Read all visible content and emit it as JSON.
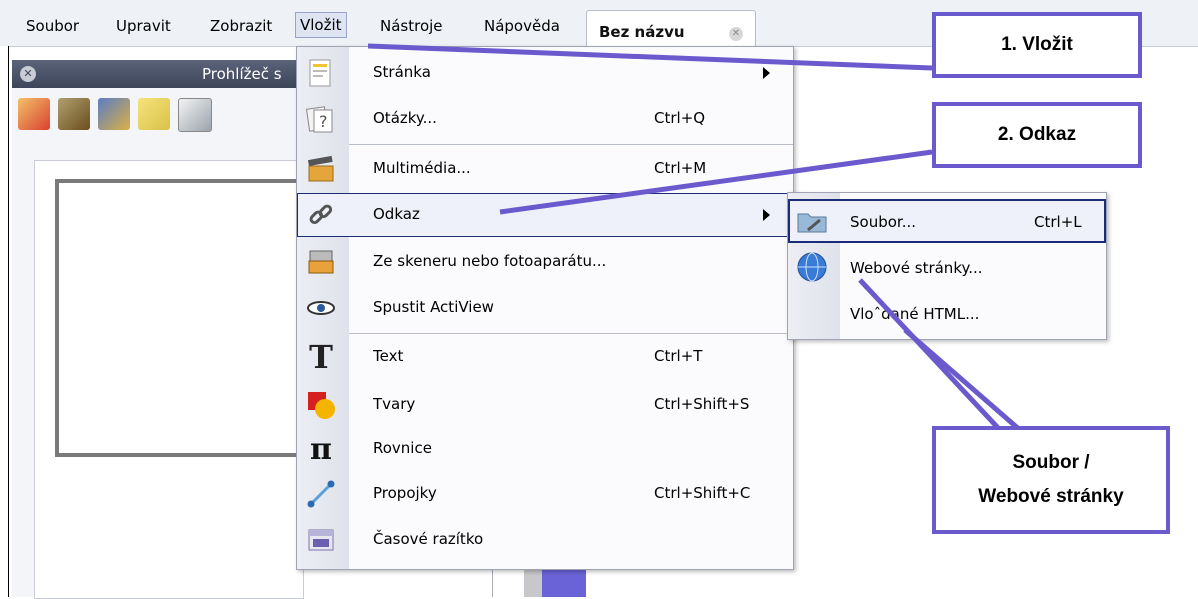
{
  "menubar": {
    "items": [
      "Soubor",
      "Upravit",
      "Zobrazit",
      "Vložit",
      "Nástroje",
      "Nápověda"
    ],
    "active": "Vložit"
  },
  "document_tab": {
    "label": "Bez názvu"
  },
  "browser_panel": {
    "title": "Prohlížeč s"
  },
  "insert_menu": {
    "items": [
      {
        "label": "Stránka",
        "shortcut": "",
        "submenu": true
      },
      {
        "label": "Otázky...",
        "shortcut": "Ctrl+Q"
      },
      {
        "label": "Multimédia...",
        "shortcut": "Ctrl+M"
      },
      {
        "label": "Odkaz",
        "shortcut": "",
        "submenu": true
      },
      {
        "label": "Ze skeneru nebo fotoaparátu...",
        "shortcut": ""
      },
      {
        "label": "Spustit ActiView",
        "shortcut": ""
      },
      {
        "label": "Text",
        "shortcut": "Ctrl+T"
      },
      {
        "label": "Tvary",
        "shortcut": "Ctrl+Shift+S"
      },
      {
        "label": "Rovnice",
        "shortcut": ""
      },
      {
        "label": "Propojky",
        "shortcut": "Ctrl+Shift+C"
      },
      {
        "label": "Časové razítko",
        "shortcut": ""
      }
    ]
  },
  "link_submenu": {
    "items": [
      {
        "label": "Soubor...",
        "shortcut": "Ctrl+L"
      },
      {
        "label": "Webové stránky...",
        "shortcut": ""
      },
      {
        "label": "Vloˆdané HTML...",
        "shortcut": ""
      }
    ]
  },
  "callouts": {
    "step1": "1. Vložit",
    "step2": "2. Odkaz",
    "step3_line1": "Soubor /",
    "step3_line2": "Webové stránky"
  },
  "colors": {
    "callout_border": "#6a5acd",
    "highlight_border": "#1c2a7a"
  }
}
